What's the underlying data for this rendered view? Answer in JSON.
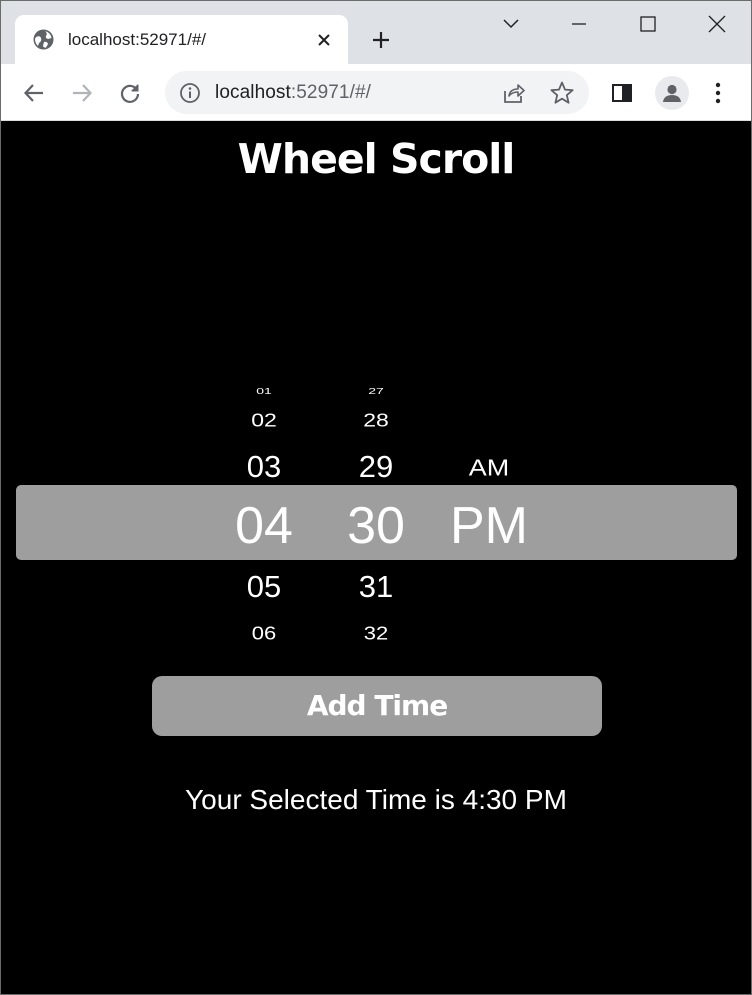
{
  "browser": {
    "tab": {
      "title": "localhost:52971/#/"
    },
    "address_bar": {
      "host": "localhost",
      "rest": ":52971/#/"
    }
  },
  "page": {
    "title": "Wheel Scroll",
    "hours": {
      "far_prev": "01",
      "prev2": "02",
      "prev1": "03",
      "selected": "04",
      "next1": "05",
      "next2": "06"
    },
    "minutes": {
      "far_prev": "27",
      "prev2": "28",
      "prev1": "29",
      "selected": "30",
      "next1": "31",
      "next2": "32"
    },
    "period": {
      "prev1": "AM",
      "selected": "PM"
    },
    "add_button_label": "Add Time",
    "result_text": "Your Selected Time is 4:30 PM"
  },
  "colors": {
    "page_background": "#000000",
    "highlight_band": "#9e9e9e",
    "button_background": "#9e9e9e",
    "text": "#ffffff"
  },
  "icons": {
    "favicon": "globe-icon",
    "tab_close": "close-icon",
    "new_tab": "plus-icon",
    "back": "arrow-left-icon",
    "forward": "arrow-right-icon",
    "reload": "reload-icon",
    "site_info": "info-icon",
    "share": "share-icon",
    "bookmark": "star-icon",
    "side_panel": "side-panel-icon",
    "profile": "profile-icon",
    "menu": "kebab-menu-icon"
  }
}
